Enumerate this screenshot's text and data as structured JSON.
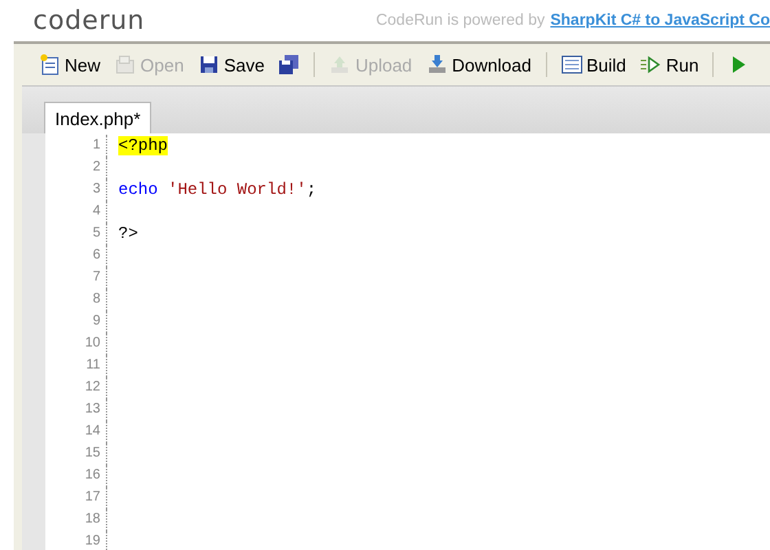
{
  "header": {
    "logo": "coderun",
    "tagline": "CodeRun is powered by",
    "link": "SharpKit C# to JavaScript Co"
  },
  "toolbar": [
    {
      "kind": "button",
      "label": "New",
      "disabled": false
    },
    {
      "kind": "button",
      "label": "Open",
      "disabled": true
    },
    {
      "kind": "button",
      "label": "Save",
      "disabled": false
    },
    {
      "kind": "icon",
      "disabled": false
    },
    {
      "kind": "separator"
    },
    {
      "kind": "button",
      "label": "Upload",
      "disabled": true
    },
    {
      "kind": "button",
      "label": "Download",
      "disabled": false
    },
    {
      "kind": "separator"
    },
    {
      "kind": "button",
      "label": "Build",
      "disabled": false
    },
    {
      "kind": "button",
      "label": "Run",
      "disabled": false
    },
    {
      "kind": "separator"
    },
    {
      "kind": "icon",
      "disabled": false
    }
  ],
  "tabs": [
    {
      "label": "Index.php*",
      "selected": true
    }
  ],
  "editor": {
    "lines": [
      {
        "number": "1",
        "tokens": [
          {
            "kind": "tag",
            "text": "<?php"
          }
        ]
      },
      {
        "number": "2"
      },
      {
        "number": "3",
        "tokens": [
          {
            "kind": "keyword",
            "text": "echo"
          },
          {
            "kind": "string",
            "text": "'Hello World!'"
          },
          {
            "kind": "plain",
            "text": ";"
          }
        ]
      },
      {
        "number": "4"
      },
      {
        "number": "5",
        "tokens": [
          {
            "kind": "plain",
            "text": "?>"
          }
        ]
      },
      {
        "number": "6"
      },
      {
        "number": "7"
      },
      {
        "number": "8"
      },
      {
        "number": "9"
      },
      {
        "number": "10"
      },
      {
        "number": "11"
      },
      {
        "number": "12"
      },
      {
        "number": "13"
      },
      {
        "number": "14"
      },
      {
        "number": "15"
      },
      {
        "number": "16"
      },
      {
        "number": "17"
      },
      {
        "number": "18"
      },
      {
        "number": "19"
      }
    ]
  }
}
